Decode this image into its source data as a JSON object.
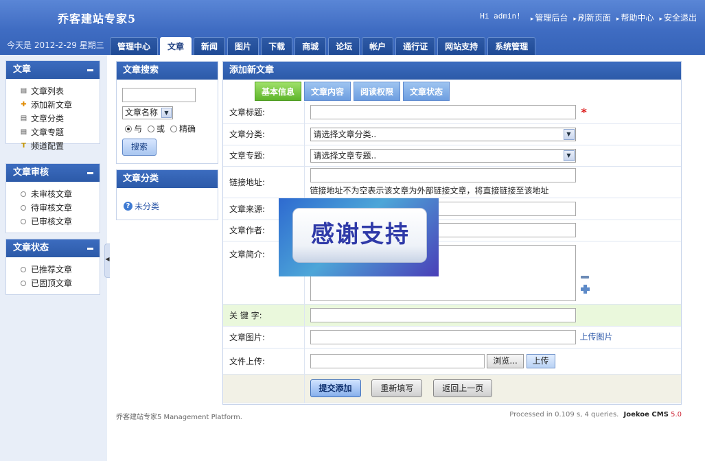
{
  "header": {
    "logo": "乔客建站专家5",
    "greeting": "Hi admin!",
    "links": [
      "管理后台",
      "刷新页面",
      "帮助中心",
      "安全退出"
    ],
    "date": "今天是 2012-2-29 星期三"
  },
  "tabs": [
    "管理中心",
    "文章",
    "新闻",
    "图片",
    "下载",
    "商城",
    "论坛",
    "帐户",
    "通行证",
    "网站支持",
    "系统管理"
  ],
  "active_tab": "文章",
  "sidebar": {
    "article": {
      "title": "文章",
      "items": [
        {
          "label": "文章列表",
          "icon": "list-icon"
        },
        {
          "label": "添加新文章",
          "icon": "add-icon"
        },
        {
          "label": "文章分类",
          "icon": "category-icon"
        },
        {
          "label": "文章专题",
          "icon": "topic-icon"
        },
        {
          "label": "频道配置",
          "icon": "key-icon"
        }
      ]
    },
    "review": {
      "title": "文章审核",
      "items": [
        "未审核文章",
        "待审核文章",
        "已审核文章"
      ]
    },
    "status": {
      "title": "文章状态",
      "items": [
        "已推荐文章",
        "已固顶文章"
      ]
    }
  },
  "search_panel": {
    "title": "文章搜索",
    "field_selected": "文章名称",
    "radios": [
      {
        "label": "与",
        "checked": true
      },
      {
        "label": "或",
        "checked": false
      },
      {
        "label": "精确",
        "checked": false
      }
    ],
    "button": "搜索"
  },
  "category_panel": {
    "title": "文章分类",
    "item": "未分类"
  },
  "form": {
    "title": "添加新文章",
    "tabs": [
      "基本信息",
      "文章内容",
      "阅读权限",
      "文章状态"
    ],
    "active_tab": "基本信息",
    "fields": {
      "title_label": "文章标题:",
      "required_mark": "*",
      "category_label": "文章分类:",
      "category_value": "请选择文章分类..",
      "topic_label": "文章专题:",
      "topic_value": "请选择文章专题..",
      "link_label": "链接地址:",
      "link_hint": "链接地址不为空表示该文章为外部链接文章，将直接链接至该地址",
      "source_label": "文章来源:",
      "author_label": "文章作者:",
      "summary_label": "文章简介:",
      "keywords_label": "关 键 字:",
      "image_label": "文章图片:",
      "image_upload_link": "上传图片",
      "file_label": "文件上传:",
      "browse_button": "浏览...",
      "upload_button": "上传"
    },
    "actions": [
      "提交添加",
      "重新填写",
      "返回上一页"
    ]
  },
  "overlay_text": "感谢支持",
  "footer": {
    "left": "乔客建站专家5 Management Platform.",
    "right": "Processed in 0.109 s, 4 queries.",
    "brand": "Joekoe CMS",
    "version": "5.0"
  }
}
